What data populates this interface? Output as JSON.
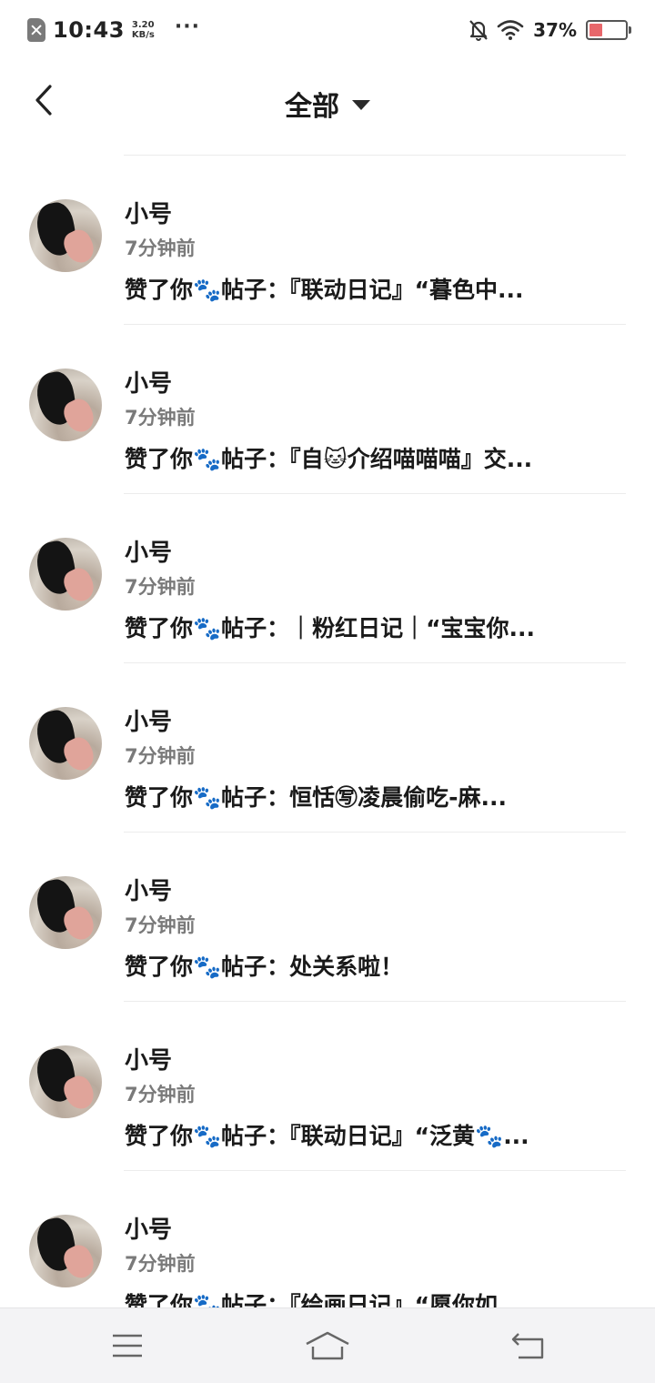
{
  "status_bar": {
    "time": "10:43",
    "speed_value": "3.20",
    "speed_unit": "KB/s",
    "dots": "···",
    "battery_percent": "37%",
    "battery_level": 0.37,
    "battery_color": "#e8676b",
    "icons": [
      "sim-off-icon",
      "bell-off-icon",
      "wifi-icon",
      "battery-icon"
    ]
  },
  "header": {
    "title": "全部",
    "back_icon": "chevron-left-icon",
    "dropdown_icon": "caret-down-icon"
  },
  "notifications": [
    {
      "name": "小号",
      "time": "7分钟前",
      "text": "赞了你🐾帖子：『联动日记』“暮色中..."
    },
    {
      "name": "小号",
      "time": "7分钟前",
      "text": "赞了你🐾帖子：『自🐱介绍喵喵喵』交..."
    },
    {
      "name": "小号",
      "time": "7分钟前",
      "text": "赞了你🐾帖子：｜粉红日记｜“宝宝你..."
    },
    {
      "name": "小号",
      "time": "7分钟前",
      "text": "赞了你🐾帖子：恒恬㊢凌晨偷吃-麻..."
    },
    {
      "name": "小号",
      "time": "7分钟前",
      "text": "赞了你🐾帖子：处关系啦！"
    },
    {
      "name": "小号",
      "time": "7分钟前",
      "text": "赞了你🐾帖子：『联动日记』“泛黄🐾..."
    },
    {
      "name": "小号",
      "time": "7分钟前",
      "text": "赞了你🐾帖子：『绘画日记』“愿你如..."
    }
  ],
  "nav_bar": {
    "icons": [
      "menu-icon",
      "home-icon",
      "back-icon"
    ]
  }
}
